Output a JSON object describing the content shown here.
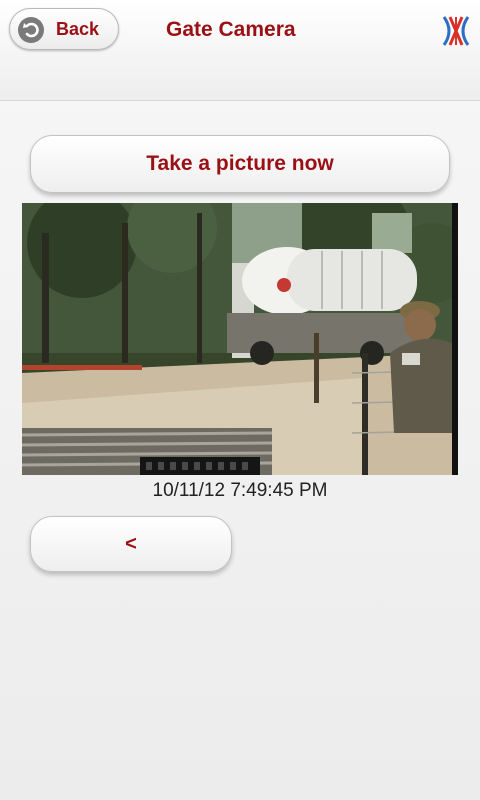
{
  "header": {
    "back_label": "Back",
    "title": "Gate Camera",
    "back_icon": "circle-arrow-back-icon",
    "logo_icon": "company-logo-icon"
  },
  "actions": {
    "take_picture_label": "Take a picture now",
    "previous_label": "<"
  },
  "camera": {
    "image_description": "gate camera photo",
    "timestamp": "10/11/12 7:49:45 PM"
  },
  "colors": {
    "accent": "#9b1014",
    "logo_blue": "#2a6fc4",
    "logo_red": "#d8312b"
  }
}
